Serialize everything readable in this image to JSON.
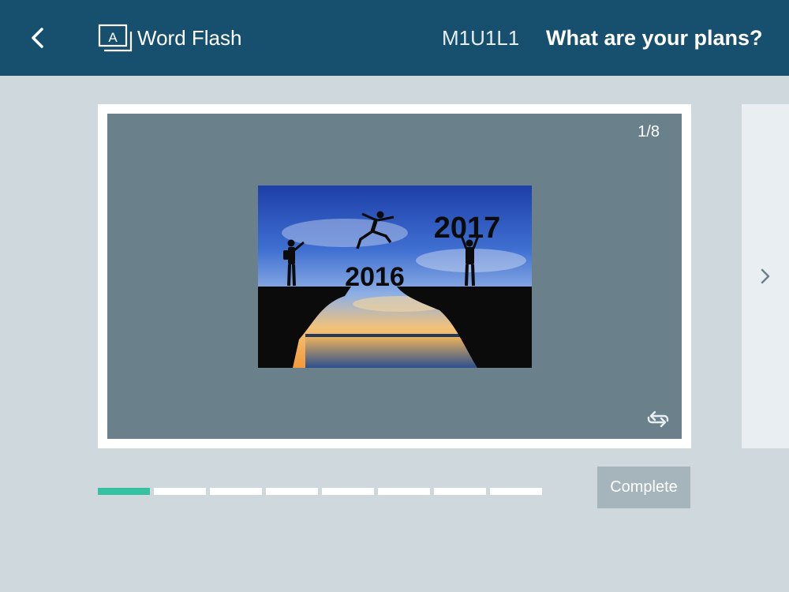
{
  "header": {
    "app_title": "Word Flash",
    "lesson_code": "M1U1L1",
    "lesson_title": "What are your plans?"
  },
  "card": {
    "page_counter": "1/8",
    "image_text_left": "2016",
    "image_text_right": "2017"
  },
  "progress": {
    "total": 8,
    "current": 1
  },
  "footer": {
    "complete_label": "Complete"
  },
  "icons": {
    "back": "chevron-left-icon",
    "app": "flashcard-icon",
    "flip": "flip-arrows-icon",
    "next": "chevron-right-icon"
  },
  "colors": {
    "header": "#174f6e",
    "background": "#cfd8dc",
    "card": "#6a818c",
    "progress_active": "#36c1a0",
    "progress_inactive": "#ffffff",
    "complete_button": "#a6b4bb"
  }
}
